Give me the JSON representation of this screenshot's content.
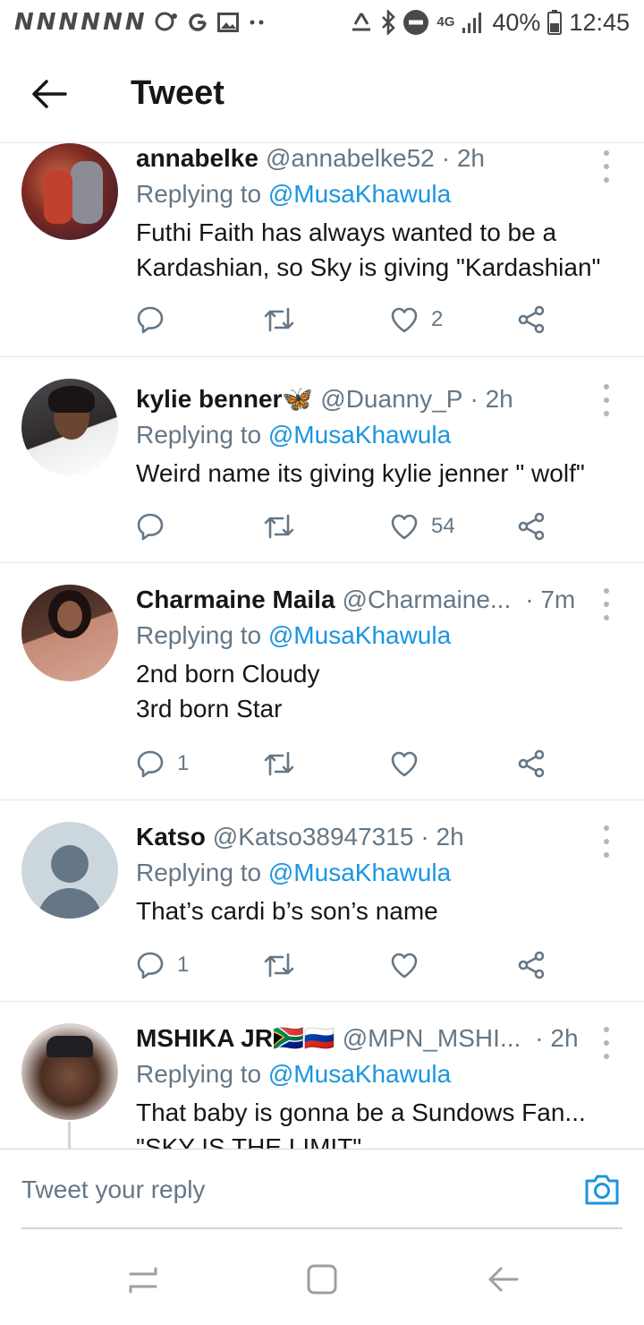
{
  "status_bar": {
    "left_glyphs": [
      "N",
      "N",
      "N",
      "N",
      "N",
      "N"
    ],
    "network": "4G",
    "battery": "40%",
    "time": "12:45"
  },
  "header": {
    "title": "Tweet"
  },
  "tweets": [
    {
      "name": "annabelke",
      "handle": "@annabelke52",
      "time": "· 2h",
      "replying_prefix": "Replying to",
      "replying_to": "@MusaKhawula",
      "text_lines": [
        "Futhi Faith has always wanted to be a",
        "Kardashian, so Sky is giving \"Kardashian\""
      ],
      "counts": {
        "reply": "",
        "retweet": "",
        "like": "2"
      }
    },
    {
      "name": "kylie benner",
      "name_suffix": "🦋",
      "handle": "@Duanny_P",
      "time": "· 2h",
      "replying_prefix": "Replying to",
      "replying_to": "@MusaKhawula",
      "text_lines": [
        "Weird name its giving kylie jenner \" wolf\""
      ],
      "counts": {
        "reply": "",
        "retweet": "",
        "like": "54"
      }
    },
    {
      "name": "Charmaine Maila",
      "handle": "@Charmaine...",
      "time": "· 7m",
      "replying_prefix": "Replying to",
      "replying_to": "@MusaKhawula",
      "text_lines": [
        "2nd born Cloudy",
        "3rd born Star"
      ],
      "counts": {
        "reply": "1",
        "retweet": "",
        "like": ""
      }
    },
    {
      "name": "Katso",
      "handle": "@Katso38947315",
      "time": "· 2h",
      "replying_prefix": "Replying to",
      "replying_to": "@MusaKhawula",
      "text_lines": [
        "That’s cardi b’s son’s name"
      ],
      "counts": {
        "reply": "1",
        "retweet": "",
        "like": ""
      }
    },
    {
      "name": "MSHIKA JR",
      "name_suffix": "🇿🇦🇷🇺",
      "handle": "@MPN_MSHI...",
      "time": "· 2h",
      "replying_prefix": "Replying to",
      "replying_to": "@MusaKhawula",
      "text_lines": [
        "That baby is gonna be a Sundows Fan...",
        "\"SKY IS THE LIMIT\""
      ],
      "counts": {
        "reply": "",
        "retweet": "",
        "like": ""
      }
    }
  ],
  "composer": {
    "placeholder": "Tweet your reply"
  },
  "colors": {
    "link": "#1b95e0",
    "muted": "#657786",
    "divider": "#e1e8ed"
  }
}
